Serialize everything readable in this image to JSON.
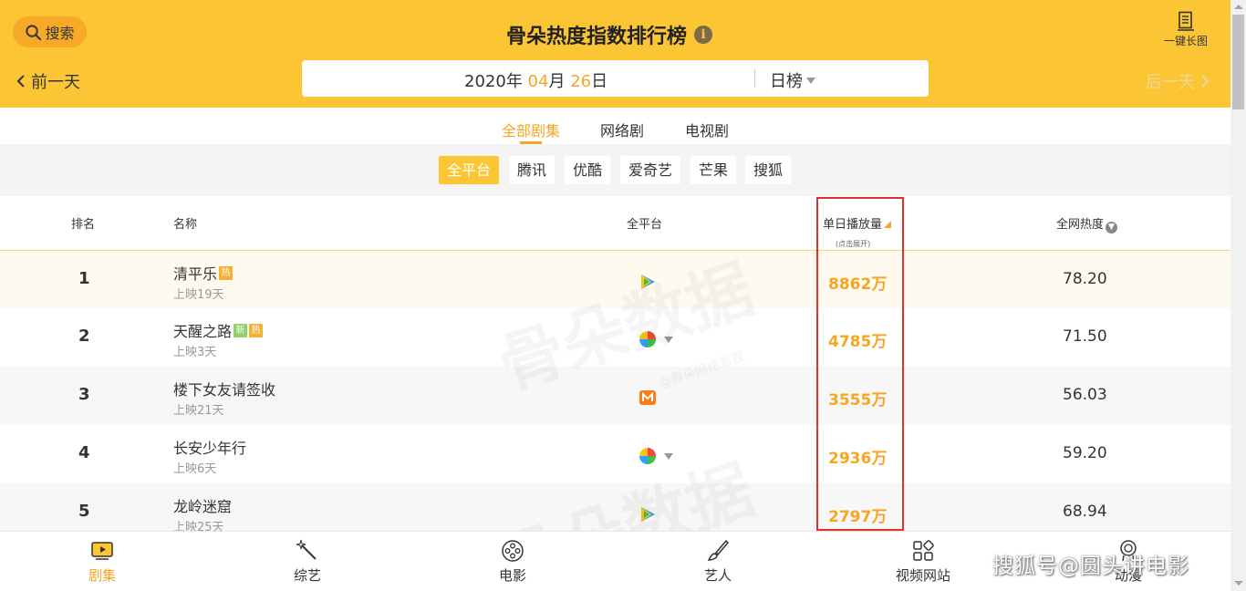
{
  "header": {
    "search_label": "搜索",
    "title": "骨朵热度指数排行榜",
    "long_image_label": "一键长图",
    "prev_day": "前一天",
    "next_day": "后一天",
    "date": {
      "year": "2020",
      "year_unit": "年",
      "month": "04",
      "month_unit": "月",
      "day": "26",
      "day_unit": "日"
    },
    "rank_type": "日榜"
  },
  "category_tabs": [
    {
      "label": "全部剧集",
      "active": true
    },
    {
      "label": "网络剧",
      "active": false
    },
    {
      "label": "电视剧",
      "active": false
    }
  ],
  "platforms": [
    {
      "label": "全平台",
      "active": true
    },
    {
      "label": "腾讯",
      "active": false
    },
    {
      "label": "优酷",
      "active": false
    },
    {
      "label": "爱奇艺",
      "active": false
    },
    {
      "label": "芒果",
      "active": false
    },
    {
      "label": "搜狐",
      "active": false
    }
  ],
  "table": {
    "headers": {
      "rank": "排名",
      "name": "名称",
      "platform": "全平台",
      "plays": "单日播放量",
      "plays_hint": "(点击展开)",
      "heat": "全网热度"
    },
    "rows": [
      {
        "rank": "1",
        "name": "清平乐",
        "badges": [
          "热"
        ],
        "sub": "上映19天",
        "platform_icon": "tencent-video-icon",
        "plays": "8862万",
        "heat": "78.20"
      },
      {
        "rank": "2",
        "name": "天醒之路",
        "badges": [
          "新",
          "热"
        ],
        "sub": "上映3天",
        "platform_icon": "multi-platform-icon",
        "plays": "4785万",
        "heat": "71.50"
      },
      {
        "rank": "3",
        "name": "楼下女友请签收",
        "badges": [],
        "sub": "上映21天",
        "platform_icon": "mango-tv-icon",
        "plays": "3555万",
        "heat": "56.03"
      },
      {
        "rank": "4",
        "name": "长安少年行",
        "badges": [],
        "sub": "上映6天",
        "platform_icon": "multi-platform-icon",
        "plays": "2936万",
        "heat": "59.20"
      },
      {
        "rank": "5",
        "name": "龙岭迷窟",
        "badges": [],
        "sub": "上映25天",
        "platform_icon": "tencent-video-icon",
        "plays": "2797万",
        "heat": "68.94"
      }
    ]
  },
  "watermark": {
    "brand": "骨朵数据",
    "sub": "@骨朵网络影视"
  },
  "bottom_nav": [
    {
      "label": "剧集",
      "icon": "tv-icon",
      "active": true
    },
    {
      "label": "综艺",
      "icon": "magic-wand-icon",
      "active": false
    },
    {
      "label": "电影",
      "icon": "film-reel-icon",
      "active": false
    },
    {
      "label": "艺人",
      "icon": "brush-icon",
      "active": false
    },
    {
      "label": "视频网站",
      "icon": "grid-apps-icon",
      "active": false
    },
    {
      "label": "动漫",
      "icon": "cartoon-icon",
      "active": false
    }
  ],
  "overlay_watermark": "搜狐号@圆头讲电影",
  "colors": {
    "header_bg": "#fbc534",
    "accent": "#f5a623",
    "highlight_border": "#e23030"
  }
}
